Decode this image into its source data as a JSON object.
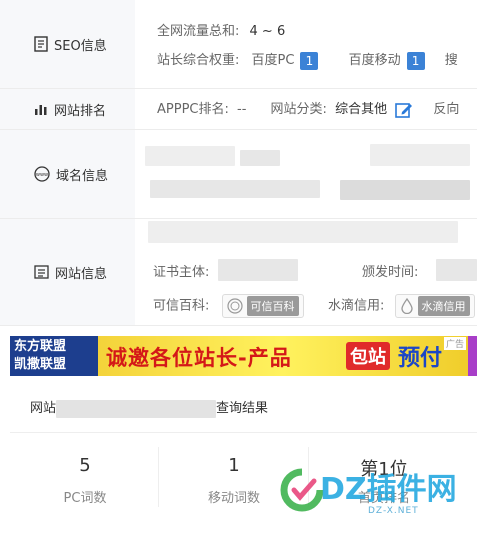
{
  "seo": {
    "label": "SEO信息",
    "traffic_label": "全网流量总和:",
    "traffic_value": "4 ~ 6",
    "weight_label": "站长综合权重:",
    "baidu_pc": "百度PC",
    "baidu_pc_val": "1",
    "baidu_mobile": "百度移动",
    "baidu_mobile_val": "1",
    "more": "搜"
  },
  "rank": {
    "label": "网站排名",
    "apppc_label": "APPPC排名:",
    "apppc_value": "--",
    "category_label": "网站分类:",
    "category_value": "综合其他",
    "reverse": "反向"
  },
  "domain": {
    "label": "域名信息"
  },
  "site": {
    "label": "网站信息",
    "cert_label": "证书主体:",
    "issue_label": "颁发时间:",
    "baike_label": "可信百科:",
    "baike_chip": "可信百科",
    "water_label": "水滴信用:",
    "water_chip": "水滴信用"
  },
  "banner": {
    "left_line1": "东方联盟",
    "left_line2": "凯撒联盟",
    "main_text": "诚邀各位站长-产品",
    "pack": "包站",
    "prepay": "预付",
    "ad_tag": "广告"
  },
  "query": {
    "prefix": "网站",
    "suffix": "查询结果",
    "stats": [
      {
        "num": "5",
        "cap": "PC词数"
      },
      {
        "num": "1",
        "cap": "移动词数"
      },
      {
        "num": "第1位",
        "cap": "首页排名"
      }
    ]
  },
  "watermark": {
    "word": "DZ插件网",
    "sub": "DZ-X.NET"
  }
}
